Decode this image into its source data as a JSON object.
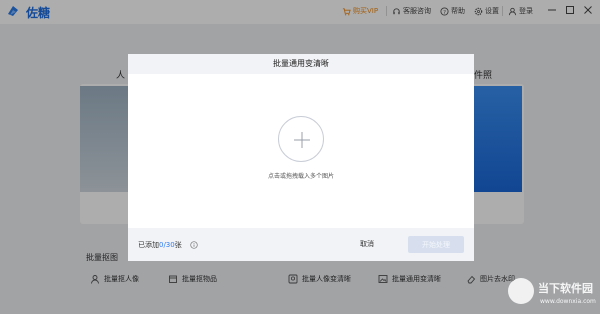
{
  "app": {
    "name": "佐糖"
  },
  "titlebar": {
    "buy_vip": "购买VIP",
    "support": "客服咨询",
    "help": "帮助",
    "settings": "设置",
    "login": "登录"
  },
  "background": {
    "left_card_heading": "人",
    "right_card_heading": "件照",
    "section_title": "批量抠图",
    "tools": [
      "批量抠人像",
      "批量抠物品",
      "批量人像变清晰",
      "批量通用变清晰",
      "图片去水印"
    ]
  },
  "modal": {
    "title": "批量通用变清晰",
    "hint": "点击或拖拽载入多个图片",
    "added_prefix": "已添加",
    "added_count": "0/30",
    "added_suffix": "张",
    "cancel_label": "取消",
    "start_label": "开始处理"
  },
  "watermark": {
    "text": "当下软件园",
    "url": "www.downxia.com"
  },
  "colors": {
    "brand": "#1f6fe0",
    "vip": "#f08a16",
    "count": "#2f7bf2"
  }
}
